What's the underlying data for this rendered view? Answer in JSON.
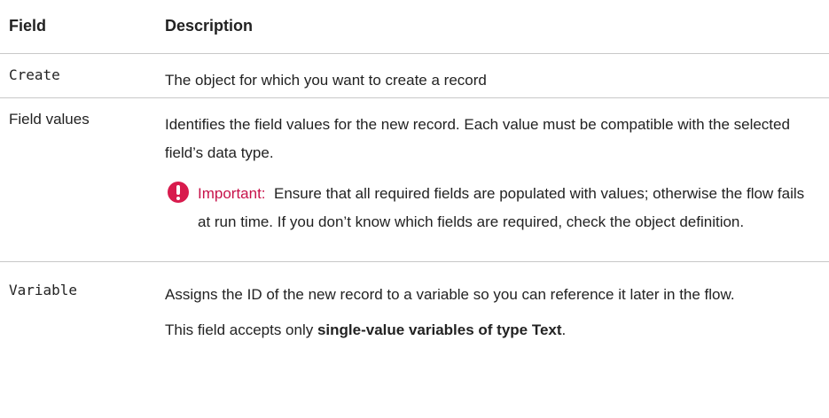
{
  "table": {
    "headers": {
      "field": "Field",
      "description": "Description"
    },
    "rows": [
      {
        "name": "Create",
        "description": "The object for which you want to create a record"
      },
      {
        "name": "Field values",
        "description": "Identifies the field values for the new record. Each value must be compatible with the selected field’s data type.",
        "important": {
          "label": "Important:",
          "text": "Ensure that all required fields are populated with values; otherwise the flow fails at run time. If you don’t know which fields are required, check the object definition."
        }
      },
      {
        "name": "Variable",
        "description": "Assigns the ID of the new record to a variable so you can reference it later in the flow.",
        "note": {
          "prefix": "This field accepts only ",
          "bold": "single-value variables of type Text",
          "suffix": "."
        }
      }
    ]
  },
  "colors": {
    "important_accent": "#c7124a",
    "icon_fill": "#d81b4d",
    "divider": "#c8c8c8"
  },
  "icons": {
    "important": "exclamation-circle-icon"
  }
}
